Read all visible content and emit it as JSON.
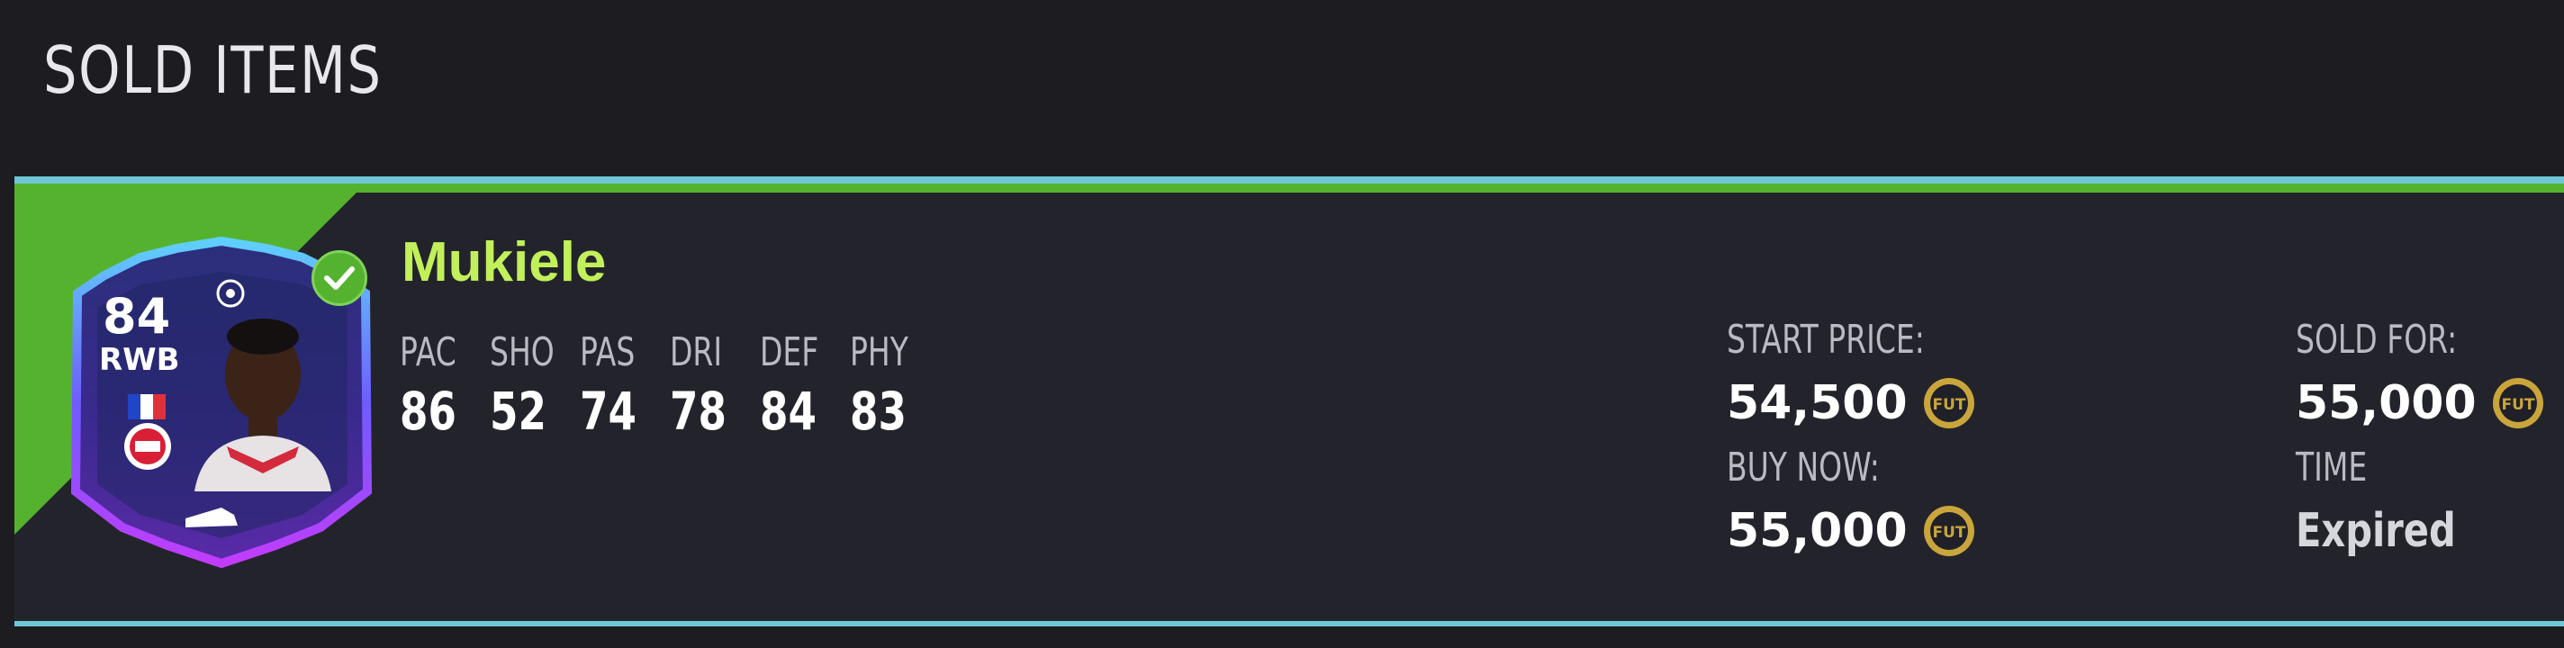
{
  "header": {
    "title": "SOLD ITEMS"
  },
  "item": {
    "card": {
      "rating": "84",
      "position": "RWB"
    },
    "player_name": "Mukiele",
    "stats": [
      {
        "label": "PAC",
        "value": "86"
      },
      {
        "label": "SHO",
        "value": "52"
      },
      {
        "label": "PAS",
        "value": "74"
      },
      {
        "label": "DRI",
        "value": "78"
      },
      {
        "label": "DEF",
        "value": "84"
      },
      {
        "label": "PHY",
        "value": "83"
      }
    ],
    "start_price_label": "START PRICE:",
    "start_price": "54,500",
    "buy_now_label": "BUY NOW:",
    "buy_now": "55,000",
    "sold_for_label": "SOLD FOR:",
    "sold_for": "55,000",
    "time_label": "TIME",
    "time_value": "Expired",
    "coin_text": "FUT"
  },
  "colors": {
    "background": "#1c1c21",
    "row_background": "#23242b",
    "accent_green": "#55b22f",
    "accent_cyan": "#6fc6d4",
    "name_color": "#c2f05a",
    "coin_gold": "#c9a53b"
  },
  "icons": {
    "check": "check-icon",
    "coin": "fut-coin-icon",
    "ucl": "ucl-star-icon",
    "flag": "france-flag-icon",
    "club": "rb-leipzig-badge-icon",
    "boot": "boot-icon"
  }
}
